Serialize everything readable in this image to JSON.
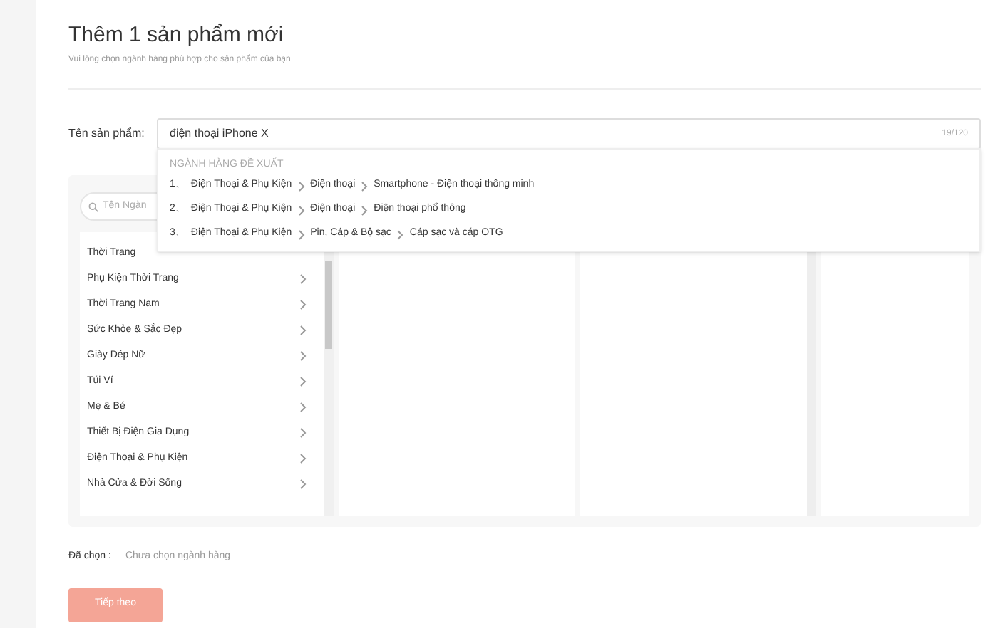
{
  "header": {
    "title": "Thêm 1 sản phẩm mới",
    "subtitle": "Vui lòng chọn ngành hàng phù hợp cho sản phẩm của bạn"
  },
  "product_name": {
    "label": "Tên sản phẩm:",
    "value": "điện thoại iPhone X",
    "counter": "19/120"
  },
  "suggestions": {
    "heading": "NGÀNH HÀNG ĐỀ XUẤT",
    "items": [
      {
        "number": "1、",
        "path": [
          "Điện Thoại & Phụ Kiện",
          "Điện thoại",
          "Smartphone - Điện thoại thông minh"
        ]
      },
      {
        "number": "2、",
        "path": [
          "Điện Thoại & Phụ Kiện",
          "Điện thoại",
          "Điện thoại phổ thông"
        ]
      },
      {
        "number": "3、",
        "path": [
          "Điện Thoại & Phụ Kiện",
          "Pin, Cáp & Bộ sạc",
          "Cáp sạc và cáp OTG"
        ]
      }
    ]
  },
  "category_search": {
    "placeholder": "Tên Ngàn"
  },
  "categories": [
    {
      "label": "Thời Trang",
      "arrow": false
    },
    {
      "label": "Phụ Kiện Thời Trang",
      "arrow": true
    },
    {
      "label": "Thời Trang Nam",
      "arrow": true
    },
    {
      "label": "Sức Khỏe & Sắc Đẹp",
      "arrow": true
    },
    {
      "label": "Giày Dép Nữ",
      "arrow": true
    },
    {
      "label": "Túi Ví",
      "arrow": true
    },
    {
      "label": "Mẹ & Bé",
      "arrow": true
    },
    {
      "label": "Thiết Bị Điện Gia Dụng",
      "arrow": true
    },
    {
      "label": "Điện Thoại & Phụ Kiện",
      "arrow": true
    },
    {
      "label": "Nhà Cửa & Đời Sống",
      "arrow": true
    }
  ],
  "selected": {
    "label": "Đã chọn :",
    "value": "Chưa chọn ngành hàng"
  },
  "next_button": {
    "label": "Tiếp theo",
    "disabled": true
  }
}
